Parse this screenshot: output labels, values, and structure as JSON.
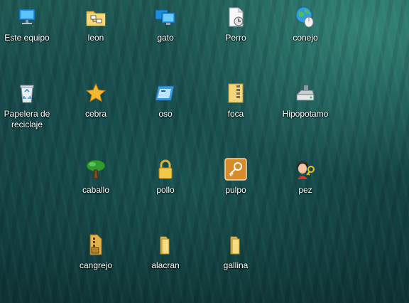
{
  "desktop": {
    "icons": [
      {
        "label": "Este equipo",
        "icon": "computer-icon"
      },
      {
        "label": "leon",
        "icon": "network-folder-icon"
      },
      {
        "label": "gato",
        "icon": "monitors-icon"
      },
      {
        "label": "Perro",
        "icon": "scheduled-file-icon"
      },
      {
        "label": "conejo",
        "icon": "globe-mouse-icon"
      },
      {
        "label": "Papelera de reciclaje",
        "icon": "recycle-bin-icon"
      },
      {
        "label": "cebra",
        "icon": "star-icon"
      },
      {
        "label": "oso",
        "icon": "window-app-icon"
      },
      {
        "label": "foca",
        "icon": "zip-folder-icon"
      },
      {
        "label": "Hipopotamo",
        "icon": "drive-icon"
      },
      {
        "label": "caballo",
        "icon": "tree-icon"
      },
      {
        "label": "pollo",
        "icon": "padlock-icon"
      },
      {
        "label": "pulpo",
        "icon": "key-tile-icon"
      },
      {
        "label": "pez",
        "icon": "user-key-icon"
      },
      {
        "label": "cangrejo",
        "icon": "archive-folder-icon"
      },
      {
        "label": "alacran",
        "icon": "folder-icon"
      },
      {
        "label": "gallina",
        "icon": "folder-icon"
      }
    ]
  }
}
